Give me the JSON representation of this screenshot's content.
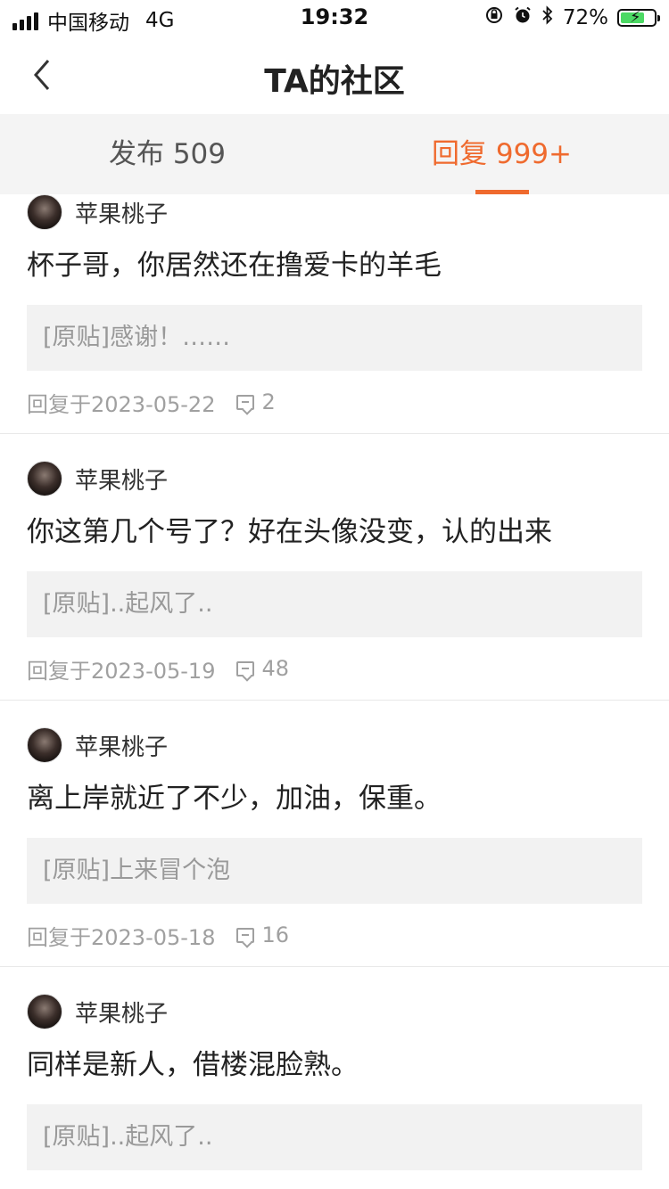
{
  "status_bar": {
    "carrier": "中国移动",
    "network": "4G",
    "time": "19:32",
    "battery_percent": "72%",
    "battery_level": 0.72
  },
  "nav": {
    "title": "TA的社区"
  },
  "tabs": [
    {
      "label": "发布 509",
      "active": false
    },
    {
      "label": "回复 999+",
      "active": true
    }
  ],
  "colors": {
    "accent": "#ef6a2e",
    "quote_bg": "#f2f2f2",
    "meta_text": "#a0a0a0"
  },
  "items": [
    {
      "user": "苹果桃子",
      "content": "杯子哥，你居然还在撸爱卡的羊毛",
      "quote": "[原贴]感谢！……",
      "date": "回复于2023-05-22",
      "comments": "2"
    },
    {
      "user": "苹果桃子",
      "content": "你这第几个号了？好在头像没变，认的出来",
      "quote": "[原贴]..起风了..",
      "date": "回复于2023-05-19",
      "comments": "48"
    },
    {
      "user": "苹果桃子",
      "content": "离上岸就近了不少，加油，保重。",
      "quote": "[原贴]上来冒个泡",
      "date": "回复于2023-05-18",
      "comments": "16"
    },
    {
      "user": "苹果桃子",
      "content": "同样是新人，借楼混脸熟。",
      "quote": "[原贴]..起风了..",
      "date": "",
      "comments": ""
    }
  ]
}
